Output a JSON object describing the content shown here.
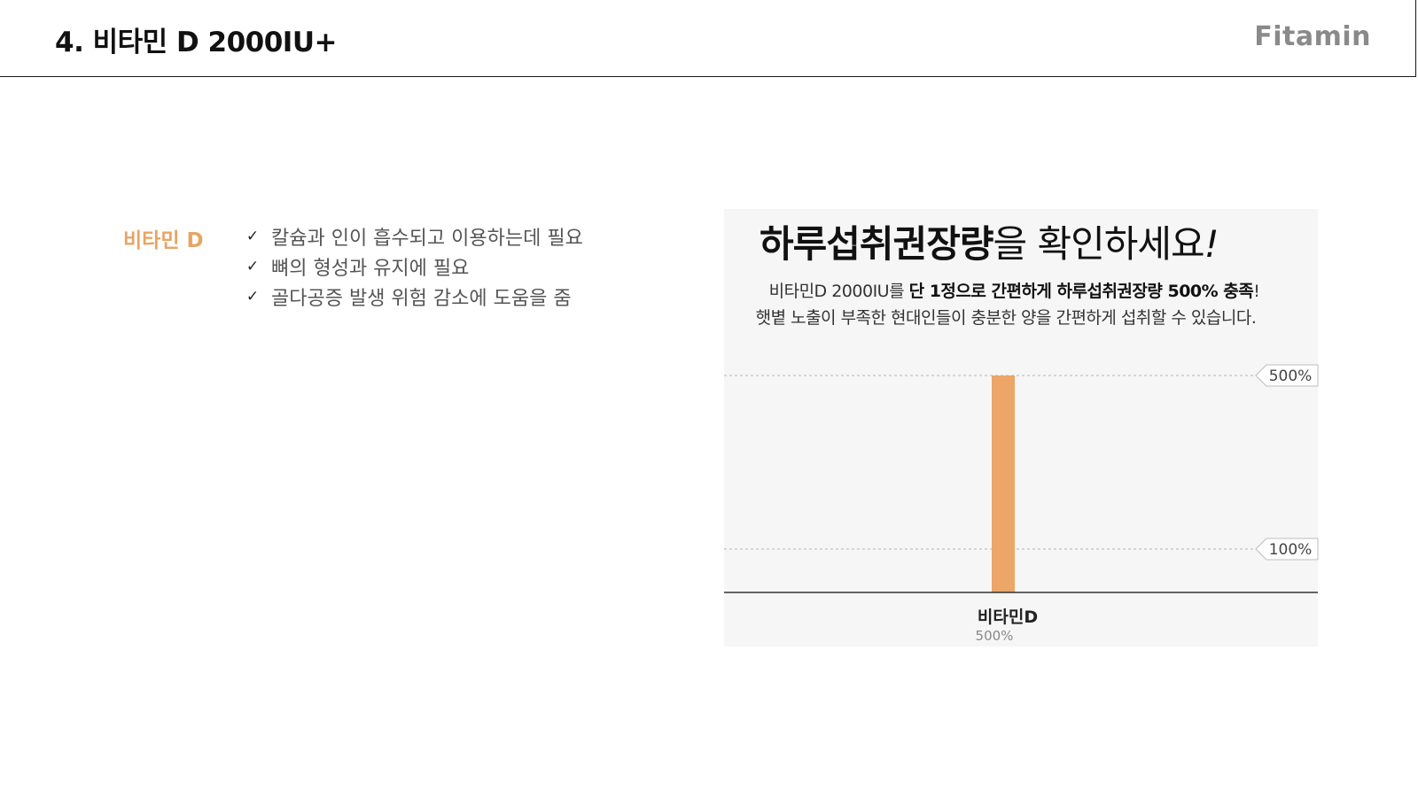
{
  "header": {
    "title": "4. 비타민 D 2000IU+",
    "logo": "Fitamin"
  },
  "section": {
    "label": "비타민 D",
    "benefits": [
      "칼슘과 인이 흡수되고 이용하는데 필요",
      "뼈의 형성과 유지에 필요",
      "골다공증 발생 위험 감소에 도움을 줌"
    ],
    "bullet_icon": "check-icon"
  },
  "panel": {
    "heading_bold": "하루섭취권장량",
    "heading_rest": "을 확인하세요",
    "heading_excl": "!",
    "desc1_pre": "비타민D 2000IU를 ",
    "desc1_bold": "단 1정으로 간편하게 하루섭취권장량 500% 충족",
    "desc1_post": "!",
    "desc2": "햇볕 노출이 부족한 현대인들이 충분한 양을 간편하게 섭취할 수 있습니다."
  },
  "chart_data": {
    "type": "bar",
    "categories": [
      "비타민D"
    ],
    "values": [
      500
    ],
    "value_labels": [
      "500%"
    ],
    "reference_lines": [
      {
        "value": 500,
        "label": "500%"
      },
      {
        "value": 100,
        "label": "100%"
      }
    ],
    "unit": "%",
    "ylim": [
      0,
      500
    ],
    "bar_color": "#eba668",
    "grid": false,
    "legend": "none"
  }
}
